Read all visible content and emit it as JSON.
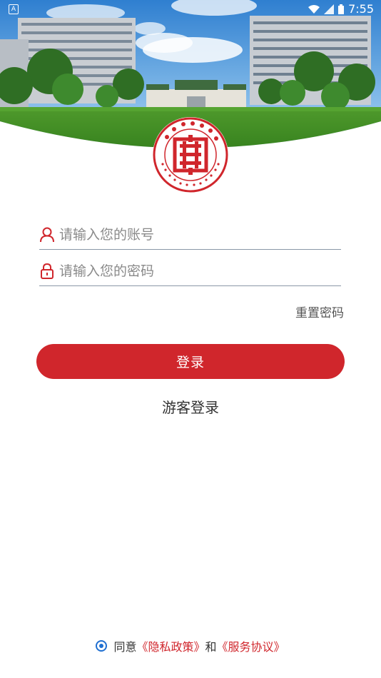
{
  "status_bar": {
    "time": "7:55",
    "left_icon": "A",
    "icons": [
      "wifi-icon",
      "signal-icon",
      "battery-icon"
    ]
  },
  "logo": {
    "ring_text_top": "广州市华夏职业学院",
    "ring_text_bottom": "GUANG ZHOU HUA XIA VOCATIONAL COLLEGE",
    "brand_color": "#d0262c"
  },
  "form": {
    "account_placeholder": "请输入您的账号",
    "password_placeholder": "请输入您的密码",
    "account_value": "",
    "password_value": "",
    "reset_password": "重置密码",
    "login_label": "登录",
    "guest_login": "游客登录"
  },
  "agreement": {
    "agree": "同意",
    "privacy_policy": "《隐私政策》",
    "and": "和",
    "service_agreement": "《服务协议》",
    "checked": true
  },
  "colors": {
    "primary": "#d0262c",
    "radio": "#1f6fd1",
    "underline": "#8a97a7"
  }
}
